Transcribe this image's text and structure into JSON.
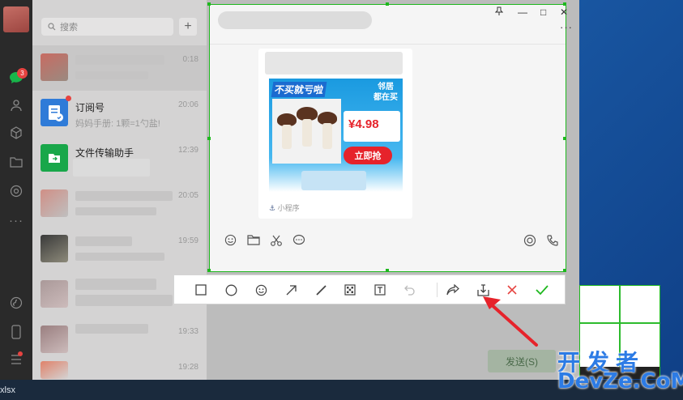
{
  "sidebar": {
    "unread_badge": "3"
  },
  "session_list": {
    "search_placeholder": "搜索",
    "add_symbol": "+",
    "sessions": [
      {
        "name": "",
        "preview": "",
        "time": "0:18"
      },
      {
        "name": "订阅号",
        "preview": "妈妈手册: 1颗=1勺盐!",
        "time": "20:06"
      },
      {
        "name": "文件传输助手",
        "preview": "",
        "time": "12:39"
      },
      {
        "name": "",
        "preview": "",
        "time": "20:05"
      },
      {
        "name": "",
        "preview": "",
        "time": "19:59"
      },
      {
        "name": "",
        "preview": "",
        "time": "19:33"
      },
      {
        "name": "",
        "preview": "",
        "time": "19:28"
      }
    ]
  },
  "chat": {
    "send_label": "发送(S)",
    "card": {
      "ad_title": "不买就亏啦",
      "ad_side_line1": "邻居",
      "ad_side_line2": "都在买",
      "price": "¥4.98",
      "cta": "立即抢",
      "mini_program": "小程序"
    }
  },
  "taskbar": {
    "label": "xlsx"
  },
  "watermark": {
    "line1": "开发者",
    "line2": "DevZe.CoM"
  },
  "colors": {
    "selection_border": "#1eb81e",
    "confirm": "#1eb81e",
    "cancel": "#e64340",
    "arrow": "#e6232b"
  }
}
